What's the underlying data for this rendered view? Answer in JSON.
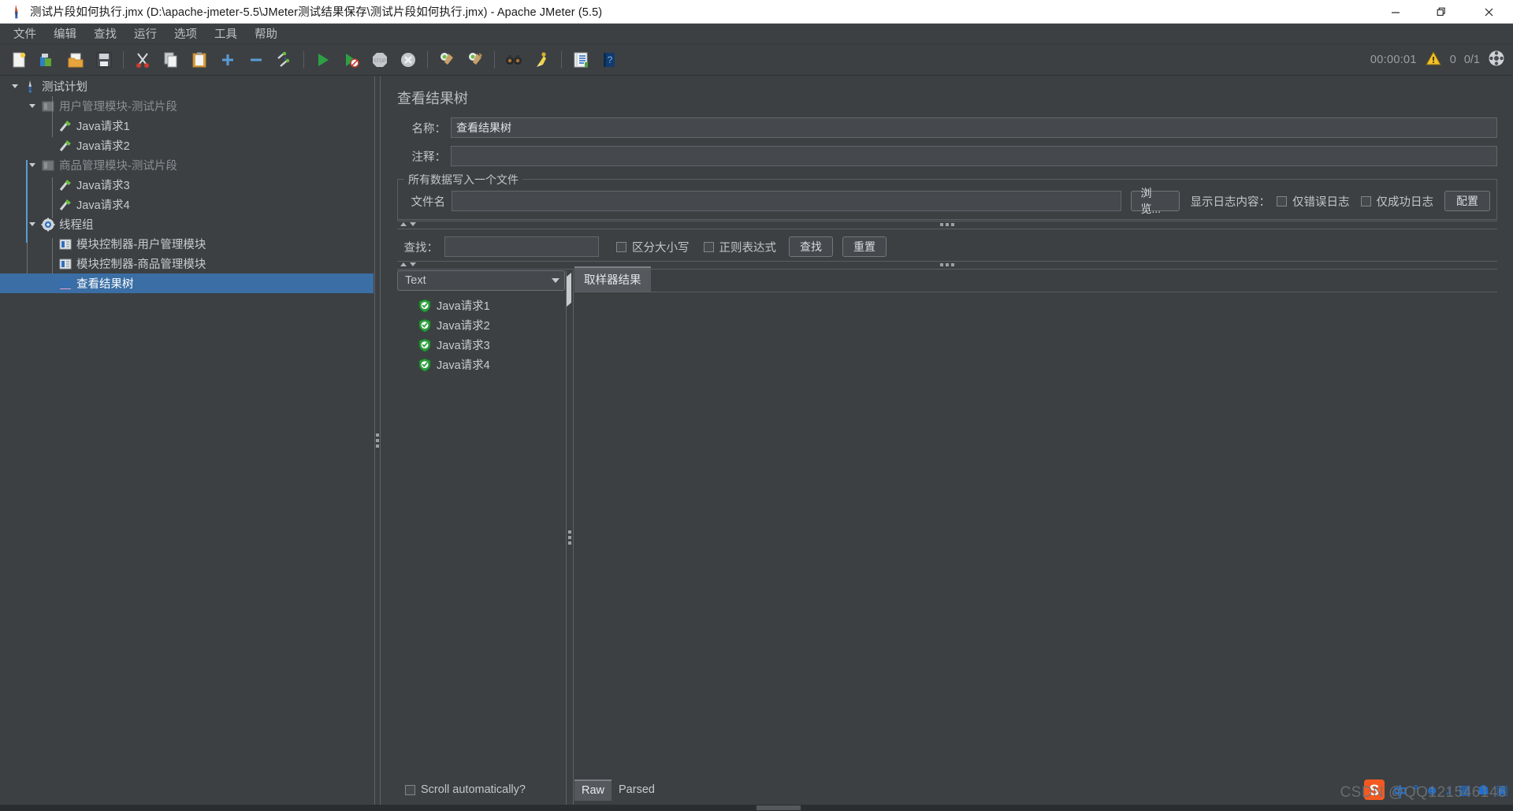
{
  "window": {
    "title": "测试片段如何执行.jmx (D:\\apache-jmeter-5.5\\JMeter测试结果保存\\测试片段如何执行.jmx) - Apache JMeter (5.5)",
    "app_icon": "jmeter-icon",
    "controls": {
      "minimize": "—",
      "restore": "❐",
      "close": "✕"
    }
  },
  "menubar": {
    "items": [
      {
        "label": "文件",
        "name": "menu-file"
      },
      {
        "label": "编辑",
        "name": "menu-edit"
      },
      {
        "label": "查找",
        "name": "menu-search"
      },
      {
        "label": "运行",
        "name": "menu-run"
      },
      {
        "label": "选项",
        "name": "menu-options"
      },
      {
        "label": "工具",
        "name": "menu-tools"
      },
      {
        "label": "帮助",
        "name": "menu-help"
      }
    ]
  },
  "toolbar": {
    "buttons": [
      {
        "name": "new-icon",
        "tip": "新建"
      },
      {
        "name": "templates-icon",
        "tip": "模板"
      },
      {
        "name": "open-icon",
        "tip": "打开"
      },
      {
        "name": "save-icon",
        "tip": "保存"
      },
      {
        "name": "cut-icon",
        "tip": "剪切"
      },
      {
        "name": "copy-icon",
        "tip": "复制"
      },
      {
        "name": "paste-icon",
        "tip": "粘贴"
      },
      {
        "name": "expand-all-icon",
        "tip": "展开"
      },
      {
        "name": "collapse-all-icon",
        "tip": "收起"
      },
      {
        "name": "toggle-icon",
        "tip": "切换"
      },
      {
        "name": "start-icon",
        "tip": "启动"
      },
      {
        "name": "start-no-pauses-icon",
        "tip": "无间隔启动"
      },
      {
        "name": "stop-icon",
        "tip": "停止"
      },
      {
        "name": "shutdown-icon",
        "tip": "关闭"
      },
      {
        "name": "clear-icon",
        "tip": "清除"
      },
      {
        "name": "clear-all-icon",
        "tip": "清除全部"
      },
      {
        "name": "search-icon",
        "tip": "查找"
      },
      {
        "name": "search-reset-icon",
        "tip": "重置查找"
      },
      {
        "name": "function-helper-icon",
        "tip": "函数助手对话框"
      },
      {
        "name": "help-icon",
        "tip": "帮助"
      }
    ],
    "status": {
      "timer": "00:00:01",
      "warning_icon": "warning-triangle-icon",
      "error_count": "0",
      "threads": "0/1",
      "thread_icon": "thread-status-icon"
    }
  },
  "tree": {
    "nodes": [
      {
        "label": "测试计划",
        "icon": "test-plan-icon",
        "depth": 0,
        "expander": "expanded",
        "selected": false,
        "disabled": false,
        "name": "tree-node-test-plan"
      },
      {
        "label": "用户管理模块-测试片段",
        "icon": "test-fragment-icon",
        "depth": 1,
        "expander": "expanded",
        "selected": false,
        "disabled": true,
        "name": "tree-node-user-fragment"
      },
      {
        "label": "Java请求1",
        "icon": "java-request-icon",
        "depth": 2,
        "expander": "none",
        "selected": false,
        "disabled": false,
        "name": "tree-node-java-request-1"
      },
      {
        "label": "Java请求2",
        "icon": "java-request-icon",
        "depth": 2,
        "expander": "none",
        "selected": false,
        "disabled": false,
        "name": "tree-node-java-request-2"
      },
      {
        "label": "商品管理模块-测试片段",
        "icon": "test-fragment-icon",
        "depth": 1,
        "expander": "expanded",
        "selected": false,
        "disabled": true,
        "name": "tree-node-product-fragment"
      },
      {
        "label": "Java请求3",
        "icon": "java-request-icon",
        "depth": 2,
        "expander": "none",
        "selected": false,
        "disabled": false,
        "name": "tree-node-java-request-3"
      },
      {
        "label": "Java请求4",
        "icon": "java-request-icon",
        "depth": 2,
        "expander": "none",
        "selected": false,
        "disabled": false,
        "name": "tree-node-java-request-4"
      },
      {
        "label": "线程组",
        "icon": "thread-group-icon",
        "depth": 1,
        "expander": "expanded",
        "selected": false,
        "disabled": false,
        "name": "tree-node-thread-group"
      },
      {
        "label": "模块控制器-用户管理模块",
        "icon": "module-controller-icon",
        "depth": 2,
        "expander": "none",
        "selected": false,
        "disabled": false,
        "name": "tree-node-module-controller-user"
      },
      {
        "label": "模块控制器-商品管理模块",
        "icon": "module-controller-icon",
        "depth": 2,
        "expander": "none",
        "selected": false,
        "disabled": false,
        "name": "tree-node-module-controller-product"
      },
      {
        "label": "查看结果树",
        "icon": "view-results-tree-icon",
        "depth": 2,
        "expander": "none",
        "selected": true,
        "disabled": false,
        "name": "tree-node-view-results-tree"
      }
    ]
  },
  "panel": {
    "title": "查看结果树",
    "name_label": "名称：",
    "name_value": "查看结果树",
    "comment_label": "注释：",
    "comment_value": "",
    "file_group_legend": "所有数据写入一个文件",
    "filename_label": "文件名",
    "filename_value": "",
    "browse_button": "浏览...",
    "log_display_label": "显示日志内容：",
    "errors_only_label": "仅错误日志",
    "errors_only_checked": false,
    "successes_only_label": "仅成功日志",
    "successes_only_checked": false,
    "configure_button": "配置"
  },
  "search": {
    "label": "查找：",
    "value": "",
    "case_sensitive_label": "区分大小写",
    "case_sensitive_checked": false,
    "regexp_label": "正则表达式",
    "regexp_checked": false,
    "search_button": "查找",
    "reset_button": "重置"
  },
  "results": {
    "renderer_selected": "Text",
    "items": [
      {
        "label": "Java请求1",
        "status": "success",
        "icon": "success-shield-icon"
      },
      {
        "label": "Java请求2",
        "status": "success",
        "icon": "success-shield-icon"
      },
      {
        "label": "Java请求3",
        "status": "success",
        "icon": "success-shield-icon"
      },
      {
        "label": "Java请求4",
        "status": "success",
        "icon": "success-shield-icon"
      }
    ],
    "tabs": [
      {
        "label": "取样器结果",
        "active": true,
        "name": "tab-sampler-result"
      }
    ],
    "scroll_auto_label": "Scroll automatically?",
    "scroll_auto_checked": false,
    "bottom_tabs": [
      {
        "label": "Raw",
        "active": true,
        "name": "tab-raw"
      },
      {
        "label": "Parsed",
        "active": false,
        "name": "tab-parsed"
      }
    ]
  },
  "watermark": {
    "text": "CSDN @QQ121546146",
    "ime": {
      "logo": "sogou-logo-icon",
      "mode": "中",
      "punct": "。，",
      "emoji": "☺",
      "mic": "Ἲ4",
      "keyboard": "⌨",
      "extras": "⬛"
    }
  },
  "colors": {
    "bg": "#3c4043",
    "selection": "#3a6ea5",
    "field_bg": "#45494d",
    "border": "#5a5e62",
    "text": "#c8ccd0",
    "muted": "#8a8f94",
    "success": "#2f9e3f",
    "accent_blue": "#5b9bd5"
  }
}
